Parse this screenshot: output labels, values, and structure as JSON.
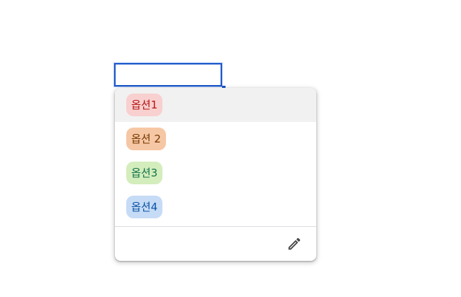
{
  "dropdown": {
    "options": [
      {
        "label": "옵션1",
        "bg": "#f8d0cf",
        "fg": "#b31412",
        "highlighted": true
      },
      {
        "label": "옵션 2",
        "bg": "#f6c7a4",
        "fg": "#753800",
        "highlighted": false
      },
      {
        "label": "옵션3",
        "bg": "#d4edbc",
        "fg": "#11734b",
        "highlighted": false
      },
      {
        "label": "옵션4",
        "bg": "#c6dbf5",
        "fg": "#0a53a8",
        "highlighted": false
      }
    ],
    "edit_icon": "pencil-icon"
  },
  "colors": {
    "selection_border": "#1a56c8",
    "highlight_row": "#f1f1f1"
  }
}
